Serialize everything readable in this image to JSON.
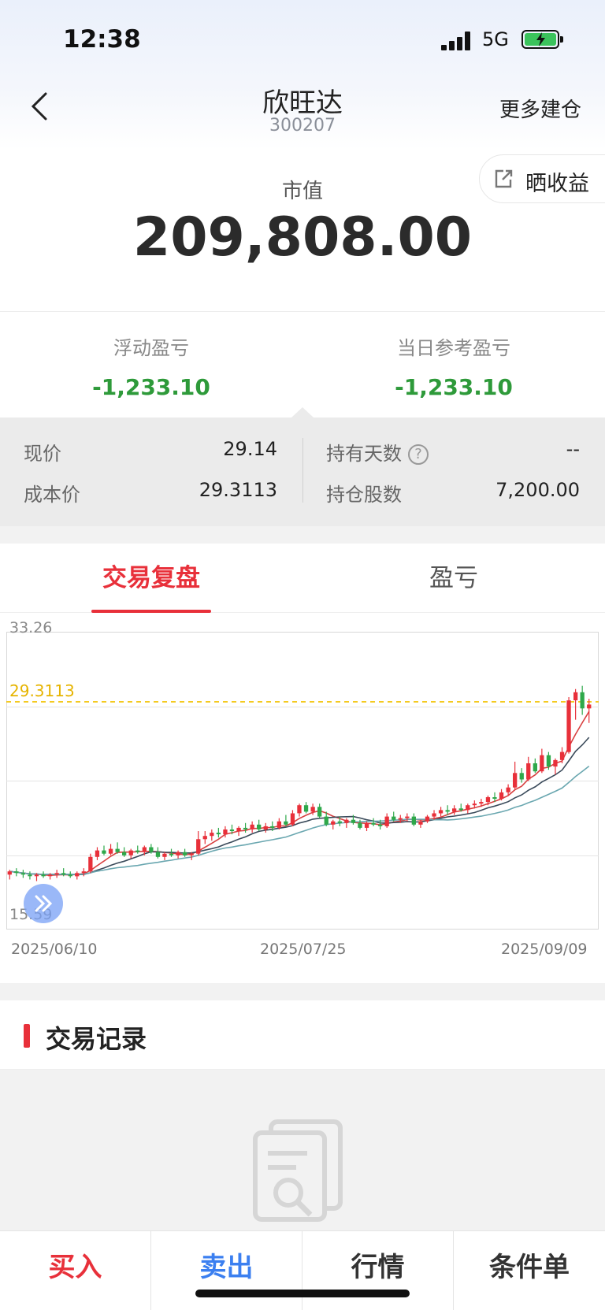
{
  "status": {
    "time": "12:38",
    "network": "5G"
  },
  "nav": {
    "title": "欣旺达",
    "code": "300207",
    "more": "更多建仓"
  },
  "share": {
    "label": "晒收益"
  },
  "market_value": {
    "label": "市值",
    "value": "209,808.00"
  },
  "pnl": {
    "floating_label": "浮动盈亏",
    "floating_value": "-1,233.10",
    "daily_label": "当日参考盈亏",
    "daily_value": "-1,233.10",
    "color_negative": "#2e9a3a"
  },
  "details": {
    "price_label": "现价",
    "price_value": "29.14",
    "cost_label": "成本价",
    "cost_value": "29.3113",
    "days_label": "持有天数",
    "days_value": "--",
    "shares_label": "持仓股数",
    "shares_value": "7,200.00"
  },
  "tabs": [
    {
      "label": "交易复盘",
      "active": true
    },
    {
      "label": "盈亏",
      "active": false
    }
  ],
  "chart_data": {
    "type": "candlestick",
    "ylim": [
      15.59,
      33.26
    ],
    "y_top_label": "33.26",
    "y_bottom_label": "15.59",
    "cost_line": 29.3113,
    "cost_label": "29.3113",
    "x_labels": [
      "2025/06/10",
      "2025/07/25",
      "2025/09/09"
    ],
    "up_color": "#e8303a",
    "down_color": "#2ea84a",
    "ma_colors": [
      "#d84040",
      "#3a4a5a",
      "#6aa7b0"
    ],
    "candles": [
      [
        18.6,
        18.9,
        18.3,
        18.8
      ],
      [
        18.8,
        19.0,
        18.5,
        18.7
      ],
      [
        18.7,
        18.9,
        18.4,
        18.6
      ],
      [
        18.6,
        18.8,
        18.3,
        18.5
      ],
      [
        18.5,
        18.7,
        18.2,
        18.6
      ],
      [
        18.6,
        18.8,
        18.4,
        18.5
      ],
      [
        18.5,
        18.7,
        18.3,
        18.6
      ],
      [
        18.6,
        18.9,
        18.4,
        18.7
      ],
      [
        18.7,
        19.0,
        18.5,
        18.6
      ],
      [
        18.6,
        18.8,
        18.4,
        18.5
      ],
      [
        18.5,
        18.8,
        18.3,
        18.7
      ],
      [
        18.7,
        19.0,
        18.5,
        18.8
      ],
      [
        18.8,
        19.9,
        18.7,
        19.7
      ],
      [
        19.7,
        20.3,
        19.5,
        20.1
      ],
      [
        20.1,
        20.4,
        19.8,
        19.9
      ],
      [
        19.9,
        20.5,
        19.8,
        20.2
      ],
      [
        20.2,
        20.6,
        19.9,
        20.0
      ],
      [
        20.0,
        20.3,
        19.7,
        19.8
      ],
      [
        19.8,
        20.2,
        19.6,
        20.1
      ],
      [
        20.1,
        20.4,
        19.9,
        20.0
      ],
      [
        20.0,
        20.4,
        19.8,
        20.3
      ],
      [
        20.3,
        20.5,
        19.9,
        20.0
      ],
      [
        20.0,
        20.3,
        19.6,
        19.7
      ],
      [
        19.7,
        20.0,
        19.5,
        19.9
      ],
      [
        19.9,
        20.2,
        19.7,
        19.8
      ],
      [
        19.8,
        20.1,
        19.6,
        20.0
      ],
      [
        20.0,
        20.2,
        19.7,
        19.8
      ],
      [
        19.8,
        20.0,
        19.5,
        19.9
      ],
      [
        19.9,
        21.3,
        19.8,
        20.8
      ],
      [
        20.8,
        21.3,
        20.5,
        21.0
      ],
      [
        21.0,
        21.4,
        20.7,
        21.2
      ],
      [
        21.2,
        21.5,
        20.9,
        21.1
      ],
      [
        21.1,
        21.6,
        20.9,
        21.4
      ],
      [
        21.4,
        21.7,
        21.1,
        21.3
      ],
      [
        21.3,
        21.6,
        21.0,
        21.5
      ],
      [
        21.5,
        21.8,
        21.2,
        21.4
      ],
      [
        21.4,
        21.9,
        21.2,
        21.7
      ],
      [
        21.7,
        22.0,
        21.3,
        21.4
      ],
      [
        21.4,
        21.8,
        21.2,
        21.6
      ],
      [
        21.6,
        21.9,
        21.3,
        21.5
      ],
      [
        21.5,
        22.1,
        21.4,
        21.9
      ],
      [
        21.9,
        22.3,
        21.6,
        21.7
      ],
      [
        21.7,
        22.6,
        21.6,
        22.4
      ],
      [
        22.4,
        23.0,
        22.2,
        22.9
      ],
      [
        22.9,
        23.1,
        22.4,
        22.5
      ],
      [
        22.5,
        23.0,
        22.3,
        22.8
      ],
      [
        22.8,
        23.0,
        22.1,
        22.2
      ],
      [
        22.2,
        22.5,
        21.6,
        21.7
      ],
      [
        21.7,
        22.0,
        21.4,
        21.9
      ],
      [
        21.9,
        22.2,
        21.6,
        21.8
      ],
      [
        21.8,
        22.1,
        21.5,
        22.0
      ],
      [
        22.0,
        22.3,
        21.7,
        21.8
      ],
      [
        21.8,
        22.0,
        21.4,
        21.5
      ],
      [
        21.5,
        21.9,
        21.3,
        21.8
      ],
      [
        21.8,
        22.1,
        21.6,
        21.7
      ],
      [
        21.7,
        22.0,
        21.4,
        21.6
      ],
      [
        21.6,
        22.4,
        21.5,
        22.2
      ],
      [
        22.2,
        22.5,
        21.9,
        22.0
      ],
      [
        22.0,
        22.3,
        21.8,
        22.1
      ],
      [
        22.1,
        22.4,
        21.9,
        22.2
      ],
      [
        22.2,
        22.4,
        21.6,
        21.7
      ],
      [
        21.7,
        22.0,
        21.5,
        21.9
      ],
      [
        21.9,
        22.3,
        21.8,
        22.2
      ],
      [
        22.2,
        22.6,
        22.0,
        22.4
      ],
      [
        22.4,
        22.8,
        22.2,
        22.6
      ],
      [
        22.6,
        22.9,
        22.3,
        22.5
      ],
      [
        22.5,
        22.9,
        22.3,
        22.7
      ],
      [
        22.7,
        23.0,
        22.5,
        22.6
      ],
      [
        22.6,
        23.0,
        22.4,
        22.9
      ],
      [
        22.9,
        23.2,
        22.7,
        23.0
      ],
      [
        23.0,
        23.3,
        22.8,
        23.1
      ],
      [
        23.1,
        23.5,
        22.9,
        23.4
      ],
      [
        23.4,
        23.7,
        23.1,
        23.3
      ],
      [
        23.3,
        23.9,
        23.2,
        23.7
      ],
      [
        23.7,
        24.2,
        23.5,
        24.0
      ],
      [
        24.0,
        25.6,
        23.9,
        24.9
      ],
      [
        24.9,
        25.2,
        24.3,
        24.5
      ],
      [
        24.5,
        25.9,
        24.4,
        25.5
      ],
      [
        25.5,
        25.8,
        24.9,
        25.0
      ],
      [
        25.0,
        26.4,
        24.9,
        26.0
      ],
      [
        26.0,
        26.2,
        25.1,
        25.3
      ],
      [
        25.3,
        25.8,
        24.8,
        25.7
      ],
      [
        25.7,
        26.5,
        25.5,
        26.2
      ],
      [
        26.2,
        29.6,
        26.1,
        29.4
      ],
      [
        29.4,
        30.1,
        28.2,
        29.9
      ],
      [
        29.9,
        30.3,
        28.5,
        28.9
      ],
      [
        28.9,
        29.5,
        28.0,
        29.14
      ]
    ]
  },
  "records": {
    "title": "交易记录"
  },
  "actions": [
    {
      "label": "买入",
      "color": "#e8303a"
    },
    {
      "label": "卖出",
      "color": "#3b7ff0"
    },
    {
      "label": "行情",
      "color": "#333333"
    },
    {
      "label": "条件单",
      "color": "#333333"
    }
  ]
}
